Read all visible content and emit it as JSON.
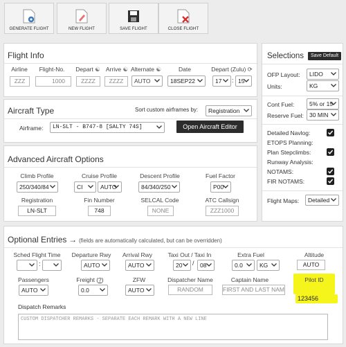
{
  "toolbar": {
    "generate": "GENERATE FLIGHT",
    "new": "NEW FLIGHT",
    "save": "SAVE FLIGHT",
    "close": "CLOSE FLIGHT"
  },
  "flight_info": {
    "title": "Flight Info",
    "headers": {
      "airline": "Airline",
      "flight_no": "Flight-No.",
      "depart": "Depart",
      "arrive": "Arrive",
      "alternate": "Alternate",
      "date": "Date",
      "depart_zulu": "Depart (Zulu)"
    },
    "airline_placeholder": "ZZZ",
    "flight_no_placeholder": "1000",
    "depart_placeholder": "ZZZZ",
    "arrive_placeholder": "ZZZZ",
    "alternate_value": "AUTO",
    "date_value": "18SEP22",
    "hour_value": "17",
    "minute_value": "15"
  },
  "aircraft": {
    "title": "Aircraft Type",
    "sort_label": "Sort custom airframes by:",
    "sort_value": "Registration",
    "airframe_label": "Airframe:",
    "airframe_value": "LN-SLT - B747-8 [SALTY 74S]",
    "editor_button": "Open Aircraft Editor"
  },
  "advanced": {
    "title": "Advanced Aircraft Options",
    "headers": {
      "climb": "Climb Profile",
      "cruise": "Cruise Profile",
      "descent": "Descent Profile",
      "fuel_factor": "Fuel Factor",
      "registration": "Registration",
      "fin": "Fin Number",
      "selcal": "SELCAL Code",
      "atc": "ATC Callsign"
    },
    "climb_value": "250/340/84",
    "cruise_value": "CI",
    "cruise_mode": "AUTO",
    "descent_value": "84/340/250",
    "fuel_factor_value": "P00",
    "registration_value": "LN-SLT",
    "fin_value": "748",
    "selcal_placeholder": "NONE",
    "atc_placeholder": "ZZZ1000"
  },
  "selections": {
    "title": "Selections",
    "save_default": "Save Default",
    "ofp_layout_label": "OFP Layout:",
    "ofp_layout_value": "LIDO",
    "units_label": "Units:",
    "units_value": "KG",
    "cont_fuel_label": "Cont Fuel:",
    "cont_fuel_value": "5% or 15",
    "reserve_fuel_label": "Reserve Fuel:",
    "reserve_fuel_value": "30 MIN",
    "options": [
      {
        "label": "Detailed Navlog:",
        "checked": true
      },
      {
        "label": "ETOPS Planning:",
        "checked": false
      },
      {
        "label": "Plan Stepclimbs:",
        "checked": true
      },
      {
        "label": "Runway Analysis:",
        "checked": false
      },
      {
        "label": "NOTAMS:",
        "checked": true
      },
      {
        "label": "FIR NOTAMS:",
        "checked": true
      }
    ],
    "flight_maps_label": "Flight Maps:",
    "flight_maps_value": "Detailed"
  },
  "optional": {
    "title": "Optional Entries",
    "arrow": "→",
    "note": "(fields are automatically calculated, but can be overridden)",
    "headers": {
      "sched": "Sched Flight Time",
      "dep_rwy": "Departure Rwy",
      "arr_rwy": "Arrival Rwy",
      "taxi": "Taxi Out / Taxi In",
      "extra_fuel": "Extra Fuel",
      "altitude": "Altitude",
      "passengers": "Passengers",
      "freight_prefix": "Freight (",
      "freight_q": "?",
      "freight_suffix": ")",
      "zfw": "ZFW",
      "dispatcher": "Dispatcher Name",
      "captain": "Captain Name",
      "pilot_id": "Pilot ID"
    },
    "dep_rwy_value": "AUTO",
    "arr_rwy_value": "AUTO",
    "taxi_out_value": "20",
    "taxi_in_value": "08",
    "extra_fuel_value": "0.0",
    "extra_fuel_unit": "KG",
    "altitude_value": "AUTO",
    "passengers_value": "AUTO",
    "freight_value": "0.0",
    "zfw_value": "AUTO",
    "dispatcher_placeholder": "RANDOM",
    "captain_placeholder": "FIRST AND LAST NAM",
    "pilot_id_value": "123456",
    "dispatch_remarks_label": "Dispatch Remarks",
    "dispatch_remarks_placeholder": "CUSTOM DISPATCHER REMARKS - SEPARATE EACH REMARK WITH A NEW LINE"
  },
  "colors": {
    "highlight": "#f5f51c",
    "dark_button": "#2c2c2c"
  }
}
